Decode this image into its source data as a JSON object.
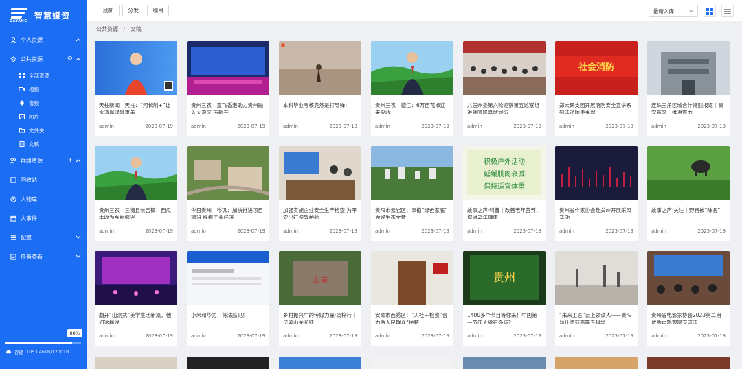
{
  "app": {
    "name": "智慧媒资",
    "logo_text": "DAYANG"
  },
  "sidebar": {
    "items": [
      {
        "label": "个人资源",
        "icon": "user-icon",
        "chevron": "^"
      },
      {
        "label": "公共资源",
        "icon": "layers-icon",
        "chevron": "^",
        "extra": "⚙"
      },
      {
        "label": "群组资源",
        "icon": "group-icon",
        "chevron": "^",
        "extra": "+"
      },
      {
        "label": "回收站",
        "icon": "recycle-icon"
      },
      {
        "label": "人物库",
        "icon": "person-icon"
      },
      {
        "label": "大事件",
        "icon": "event-icon"
      },
      {
        "label": "配置",
        "icon": "config-icon",
        "chevron": "v"
      },
      {
        "label": "任务查看",
        "icon": "task-icon",
        "chevron": "v"
      }
    ],
    "sub_items": [
      {
        "label": "全部资源",
        "icon": "grid-icon"
      },
      {
        "label": "视频",
        "icon": "video-icon"
      },
      {
        "label": "音频",
        "icon": "audio-icon"
      },
      {
        "label": "图片",
        "icon": "image-icon"
      },
      {
        "label": "文件夹",
        "icon": "folder-icon"
      },
      {
        "label": "文稿",
        "icon": "document-icon"
      }
    ],
    "storage": {
      "label": "存储",
      "value": "1053.46TB/1200TB",
      "percent_label": "88%",
      "percent": 88
    }
  },
  "toolbar": {
    "buttons": [
      "刷新",
      "分发",
      "编目"
    ],
    "sort_label": "最新入库",
    "accent": "#1b6ef3"
  },
  "breadcrumb": {
    "root": "公共资源",
    "sep": "/",
    "current": "文稿"
  },
  "cards": [
    {
      "title": "天柱新闻｜天柱：“河长制+”让水清岸绿景更美",
      "author": "admin",
      "date": "2023-07-19",
      "thumb": "news-anchor-red"
    },
    {
      "title": "贵州三农｜直飞香港助力贵州融入大湾区 南航开...",
      "author": "admin",
      "date": "2023-07-19",
      "thumb": "stage-screen"
    },
    {
      "title": "本科毕业考核竟然是打导弹！",
      "author": "admin",
      "date": "2023-07-19",
      "thumb": "desert-plant"
    },
    {
      "title": "贵州三农｜德江：6万亩花椒迎来采收",
      "author": "admin",
      "date": "2023-07-19",
      "thumb": "news-anchor-field"
    },
    {
      "title": "八届州委第六轮巡察第五巡察组进驻晴隆县城城街...",
      "author": "admin",
      "date": "2023-07-19",
      "thumb": "meeting-room"
    },
    {
      "title": "郑大研支团开展消防安全宣讲系列活动防患未然",
      "author": "admin",
      "date": "2023-07-19",
      "thumb": "red-banner"
    },
    {
      "title": "连珠三角区域合作特别报道｜贵安新区：推进算力...",
      "author": "admin",
      "date": "2023-07-19",
      "thumb": "building-gray"
    },
    {
      "title": "贵州三农｜三穗县长吉镇：西瓜丰收为乡村振兴...",
      "author": "admin",
      "date": "2023-07-19",
      "thumb": "news-anchor-field"
    },
    {
      "title": "今日贵州｜岑巩：加快推进项目建设 提振工业经济",
      "author": "admin",
      "date": "2023-07-19",
      "thumb": "aerial-town"
    },
    {
      "title": "加强实施企业安全生产检查 为平安出行保驾护航",
      "author": "admin",
      "date": "2023-07-19",
      "thumb": "office-inspection"
    },
    {
      "title": "贵阳市云岩区：厚植“绿色家底” 做好生态文章",
      "author": "admin",
      "date": "2023-07-19",
      "thumb": "city-aerial"
    },
    {
      "title": "故事之声·科普｜改善老年营养，促进老年健康",
      "author": "admin",
      "date": "2023-07-19",
      "thumb": "green-text-poster"
    },
    {
      "title": "贵州省作家协会赴关岭开展采风活动",
      "author": "admin",
      "date": "2023-07-19",
      "thumb": "dark-red-pattern"
    },
    {
      "title": "故事之声·关注｜野猪被“除名”",
      "author": "admin",
      "date": "2023-07-19",
      "thumb": "boar-grass"
    },
    {
      "title": "翻开“山洞式”美学生活新篇，他们这样说……",
      "author": "admin",
      "date": "2023-07-19",
      "thumb": "stage-purple"
    },
    {
      "title": "小米和华为，将法庭见！",
      "author": "admin",
      "date": "2023-07-19",
      "thumb": "web-page"
    },
    {
      "title": "乡村振兴中的传媒力量·阔梓行｜亿姿山关长征",
      "author": "admin",
      "date": "2023-07-19",
      "thumb": "rock-carving"
    },
    {
      "title": "安顺市西秀区：“人社＋检察”合力做人民群众”护薪...",
      "author": "admin",
      "date": "2023-07-19",
      "thumb": "office-door"
    },
    {
      "title": "1400多个节目等你来！中国第一节庆大省有多嗨？",
      "author": "admin",
      "date": "2023-07-19",
      "thumb": "green-night-sign"
    },
    {
      "title": "“未来工匠”云上领读人——贵阳幼儿师范高等专科学...",
      "author": "admin",
      "date": "2023-07-19",
      "thumb": "misty-sculpture"
    },
    {
      "title": "贵州省电影家协会2023第二期优秀电影观摩交流活...",
      "author": "admin",
      "date": "2023-07-19",
      "thumb": "screening-room"
    }
  ]
}
